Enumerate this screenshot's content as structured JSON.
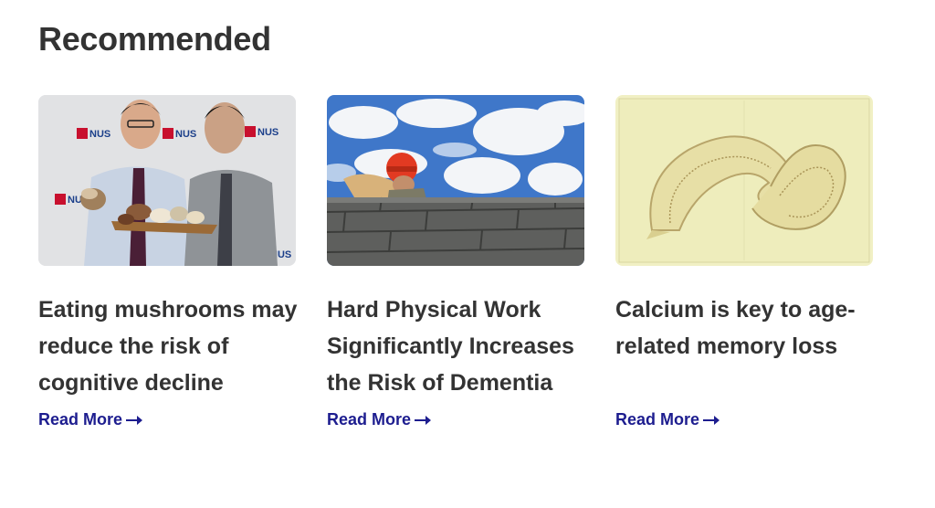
{
  "section": {
    "title": "Recommended"
  },
  "cards": [
    {
      "title": "Eating mushrooms may reduce the risk of cognitive decline",
      "read_more": "Read More",
      "image_text": "NUS"
    },
    {
      "title": "Hard Physical Work Significantly Increases the Risk of Dementia",
      "read_more": "Read More"
    },
    {
      "title": "Calcium is key to age-related memory loss",
      "read_more": "Read More"
    }
  ],
  "colors": {
    "heading": "#333333",
    "link": "#1d1d8f"
  }
}
